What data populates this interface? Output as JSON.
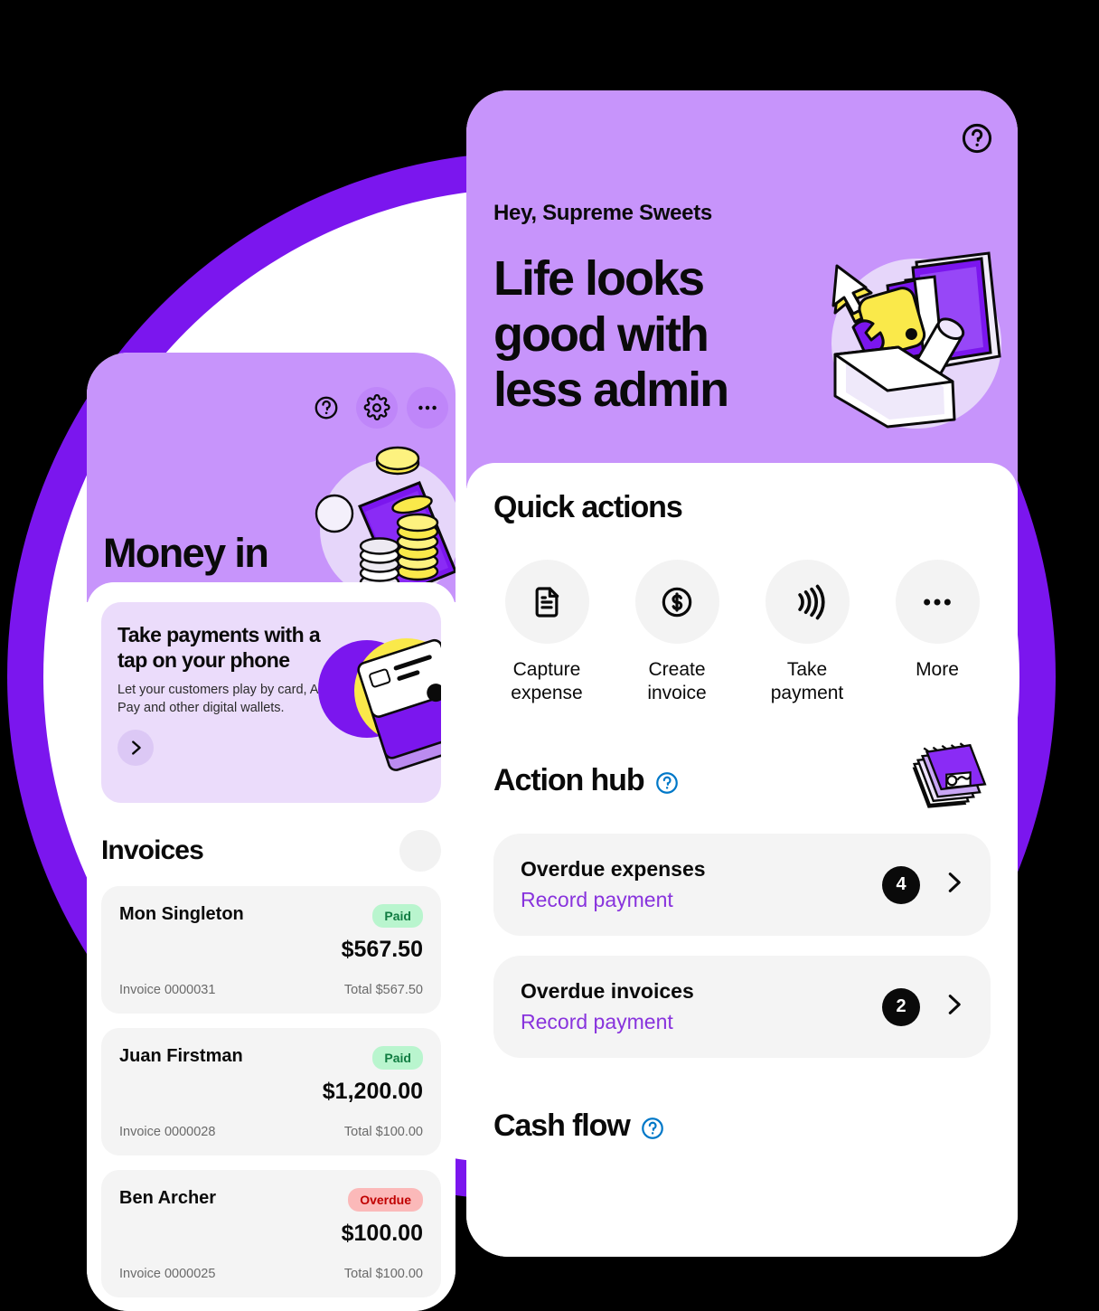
{
  "colors": {
    "brand_purple": "#7B16EE",
    "header_lilac": "#C794FB",
    "promo_bg": "#EBDCFB",
    "link_purple": "#8833DD",
    "paid_bg": "#B9F5CE",
    "paid_text": "#107C41",
    "overdue_bg": "#FBB9B9",
    "overdue_text": "#C00000",
    "help_blue": "#0078C8",
    "accent_yellow": "#FAE94A"
  },
  "back_phone": {
    "header": {
      "title": "Money in",
      "icons": [
        "help-icon",
        "gear-icon",
        "more-icon"
      ],
      "illustration": "coins-phone-illustration"
    },
    "promo": {
      "title": "Take payments with a tap on your phone",
      "subtitle": "Let your customers play by card, Apply Pay and other digital wallets.",
      "arrow_icon": "chevron-right-icon",
      "illustration": "cards-stack-illustration"
    },
    "invoices": {
      "title": "Invoices",
      "action_icon": "search-icon",
      "rows": [
        {
          "name": "Mon Singleton",
          "status": "Paid",
          "status_type": "paid",
          "amount": "$567.50",
          "reference": "Invoice 0000031",
          "total": "Total $567.50"
        },
        {
          "name": "Juan Firstman",
          "status": "Paid",
          "status_type": "paid",
          "amount": "$1,200.00",
          "reference": "Invoice 0000028",
          "total": "Total $100.00"
        },
        {
          "name": "Ben Archer",
          "status": "Overdue",
          "status_type": "overdue",
          "amount": "$100.00",
          "reference": "Invoice 0000025",
          "total": "Total $100.00"
        }
      ]
    }
  },
  "front_phone": {
    "header": {
      "help_icon": "help-icon",
      "greeting": "Hey, Supreme Sweets",
      "hero_title": "Life looks good with less admin",
      "illustration": "toolbox-computer-illustration"
    },
    "quick_actions": {
      "title": "Quick actions",
      "items": [
        {
          "label": "Capture expense",
          "icon": "document-icon"
        },
        {
          "label": "Create invoice",
          "icon": "dollar-circle-icon"
        },
        {
          "label": "Take payment",
          "icon": "contactless-icon"
        },
        {
          "label": "More",
          "icon": "ellipsis-icon"
        }
      ]
    },
    "action_hub": {
      "title": "Action hub",
      "help_icon": "help-circle-icon",
      "illustration": "notebook-files-illustration",
      "rows": [
        {
          "label": "Overdue expenses",
          "link": "Record payment",
          "count": "4",
          "chevron": "chevron-right-icon"
        },
        {
          "label": "Overdue invoices",
          "link": "Record payment",
          "count": "2",
          "chevron": "chevron-right-icon"
        }
      ]
    },
    "cash_flow": {
      "title": "Cash flow",
      "help_icon": "help-circle-icon"
    }
  }
}
